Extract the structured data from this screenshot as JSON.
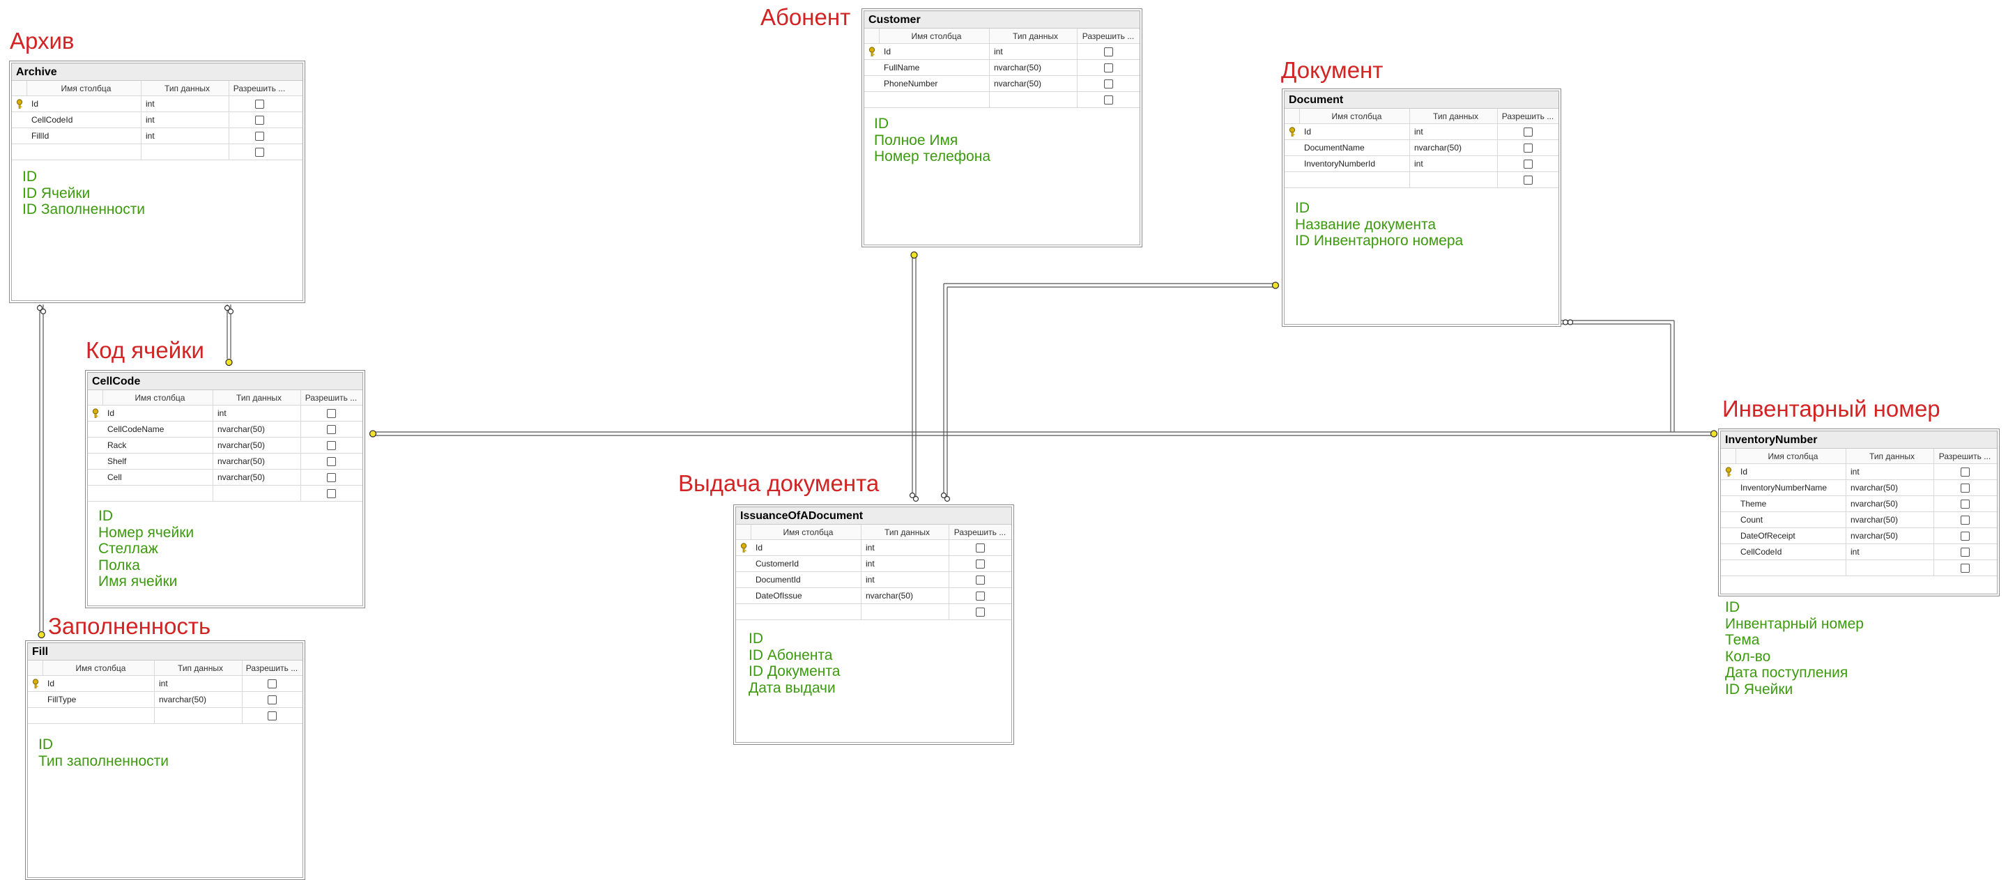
{
  "grid_headers": {
    "name": "Имя столбца",
    "type": "Тип данных",
    "nulls": "Разрешить ..."
  },
  "icons": {
    "primary_key": "key-icon",
    "nullable_checkbox": "checkbox-icon",
    "relationship_end": "relationship-end-icon"
  },
  "colors": {
    "russian_label": "#d22424",
    "field_note": "#3c9a0e",
    "connector": "#555555",
    "key_icon": "#d9b000"
  },
  "tables": [
    {
      "id": "archive",
      "label": "Архив",
      "title": "Archive",
      "columns": [
        {
          "name": "Id",
          "type": "int",
          "pk": true
        },
        {
          "name": "CellCodeId",
          "type": "int"
        },
        {
          "name": "FillId",
          "type": "int"
        }
      ],
      "notes": [
        "ID",
        "ID Ячейки",
        "ID Заполненности"
      ]
    },
    {
      "id": "customer",
      "label": "Абонент",
      "title": "Customer",
      "columns": [
        {
          "name": "Id",
          "type": "int",
          "pk": true
        },
        {
          "name": "FullName",
          "type": "nvarchar(50)"
        },
        {
          "name": "PhoneNumber",
          "type": "nvarchar(50)"
        }
      ],
      "notes": [
        "ID",
        "Полное Имя",
        "Номер телефона"
      ]
    },
    {
      "id": "document",
      "label": "Документ",
      "title": "Document",
      "columns": [
        {
          "name": "Id",
          "type": "int",
          "pk": true
        },
        {
          "name": "DocumentName",
          "type": "nvarchar(50)"
        },
        {
          "name": "InventoryNumberId",
          "type": "int"
        }
      ],
      "notes": [
        "ID",
        "Название документа",
        "ID Инвентарного номера"
      ]
    },
    {
      "id": "cellcode",
      "label": "Код ячейки",
      "title": "CellCode",
      "columns": [
        {
          "name": "Id",
          "type": "int",
          "pk": true
        },
        {
          "name": "CellCodeName",
          "type": "nvarchar(50)"
        },
        {
          "name": "Rack",
          "type": "nvarchar(50)"
        },
        {
          "name": "Shelf",
          "type": "nvarchar(50)"
        },
        {
          "name": "Cell",
          "type": "nvarchar(50)"
        }
      ],
      "notes": [
        "ID",
        "Номер ячейки",
        "Стеллаж",
        "Полка",
        "Имя ячейки"
      ]
    },
    {
      "id": "inventory",
      "label": "Инвентарный номер",
      "title": "InventoryNumber",
      "columns": [
        {
          "name": "Id",
          "type": "int",
          "pk": true
        },
        {
          "name": "InventoryNumberName",
          "type": "nvarchar(50)"
        },
        {
          "name": "Theme",
          "type": "nvarchar(50)"
        },
        {
          "name": "Count",
          "type": "nvarchar(50)"
        },
        {
          "name": "DateOfReceipt",
          "type": "nvarchar(50)"
        },
        {
          "name": "CellCodeId",
          "type": "int"
        }
      ],
      "notes": [
        "ID",
        "Инвентарный номер",
        "Тема",
        "Кол-во",
        "Дата поступления",
        "ID Ячейки"
      ]
    },
    {
      "id": "issuance",
      "label": "Выдача документа",
      "title": "IssuanceOfADocument",
      "columns": [
        {
          "name": "Id",
          "type": "int",
          "pk": true
        },
        {
          "name": "CustomerId",
          "type": "int"
        },
        {
          "name": "DocumentId",
          "type": "int"
        },
        {
          "name": "DateOfIssue",
          "type": "nvarchar(50)"
        }
      ],
      "notes": [
        "ID",
        "ID Абонента",
        "ID Документа",
        "Дата выдачи"
      ]
    },
    {
      "id": "fill",
      "label": "Заполненность",
      "title": "Fill",
      "columns": [
        {
          "name": "Id",
          "type": "int",
          "pk": true
        },
        {
          "name": "FillType",
          "type": "nvarchar(50)"
        }
      ],
      "notes": [
        "ID",
        "Тип заполненности"
      ]
    }
  ]
}
